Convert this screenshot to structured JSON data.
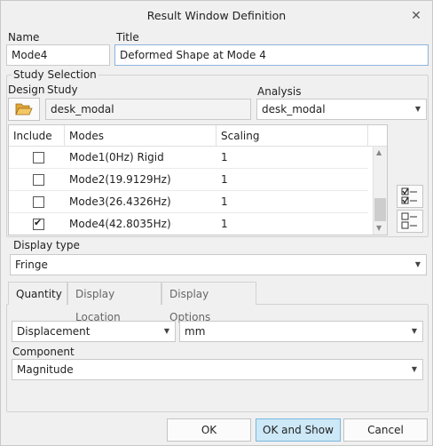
{
  "window": {
    "title": "Result Window Definition"
  },
  "name": {
    "label": "Name",
    "value": "Mode4"
  },
  "title": {
    "label": "Title",
    "value": "Deformed Shape at Mode 4"
  },
  "study_selection": {
    "label": "Study Selection",
    "design_label": "Design",
    "study_label": "Study",
    "study_value": "desk_modal",
    "analysis_label": "Analysis",
    "analysis_value": "desk_modal"
  },
  "modes_table": {
    "headers": [
      "Include",
      "Modes",
      "Scaling"
    ],
    "rows": [
      {
        "checked": false,
        "mode": "Mode1(0Hz) Rigid",
        "scaling": "1"
      },
      {
        "checked": false,
        "mode": "Mode2(19.9129Hz)",
        "scaling": "1"
      },
      {
        "checked": false,
        "mode": "Mode3(26.4326Hz)",
        "scaling": "1"
      },
      {
        "checked": true,
        "mode": "Mode4(42.8035Hz)",
        "scaling": "1"
      }
    ]
  },
  "display_type": {
    "label": "Display type",
    "value": "Fringe"
  },
  "tabs": [
    "Quantity",
    "Display Location",
    "Display Options"
  ],
  "quantity": {
    "quantity_value": "Displacement",
    "unit_value": "mm",
    "component_label": "Component",
    "component_value": "Magnitude"
  },
  "buttons": {
    "ok": "OK",
    "ok_show": "OK and Show",
    "cancel": "Cancel"
  }
}
